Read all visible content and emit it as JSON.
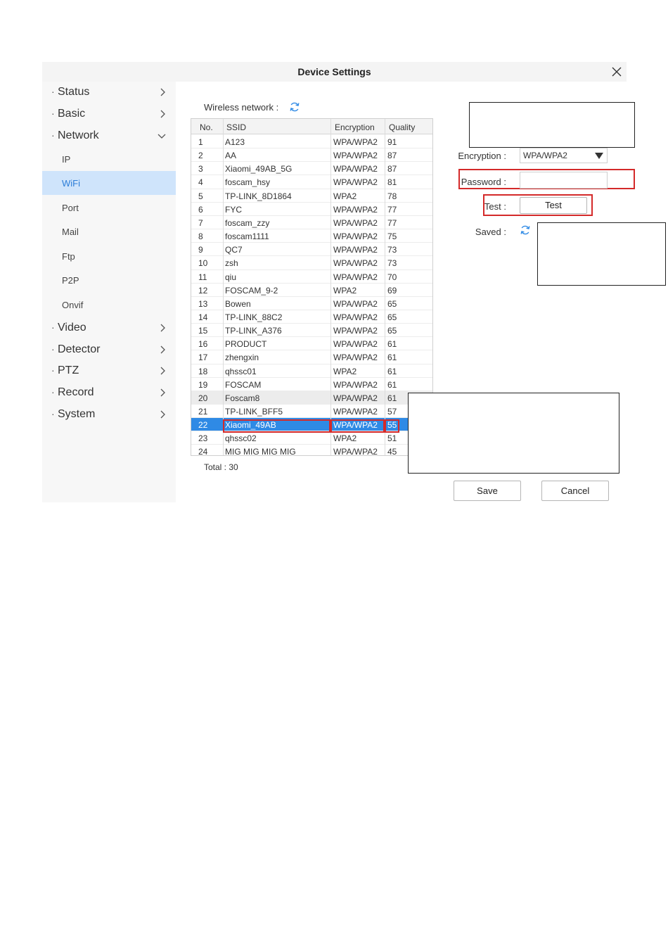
{
  "window": {
    "title": "Device Settings"
  },
  "sidebar": {
    "items": [
      {
        "label": "Status"
      },
      {
        "label": "Basic"
      },
      {
        "label": "Network"
      }
    ],
    "network_sub": [
      {
        "label": "IP"
      },
      {
        "label": "WiFi"
      },
      {
        "label": "Port"
      },
      {
        "label": "Mail"
      },
      {
        "label": "Ftp"
      },
      {
        "label": "P2P"
      },
      {
        "label": "Onvif"
      }
    ],
    "items_after": [
      {
        "label": "Video"
      },
      {
        "label": "Detector"
      },
      {
        "label": "PTZ"
      },
      {
        "label": "Record"
      },
      {
        "label": "System"
      }
    ],
    "active_sub": "WiFi"
  },
  "wifi": {
    "wireless_label": "Wireless network :",
    "columns": [
      "No.",
      "SSID",
      "Encryption",
      "Quality"
    ],
    "rows": [
      [
        "1",
        "A123",
        "WPA/WPA2",
        "91"
      ],
      [
        "2",
        "AA",
        "WPA/WPA2",
        "87"
      ],
      [
        "3",
        "Xiaomi_49AB_5G",
        "WPA/WPA2",
        "87"
      ],
      [
        "4",
        "foscam_hsy",
        "WPA/WPA2",
        "81"
      ],
      [
        "5",
        "TP-LINK_8D1864",
        "WPA2",
        "78"
      ],
      [
        "6",
        "FYC",
        "WPA/WPA2",
        "77"
      ],
      [
        "7",
        "foscam_zzy",
        "WPA/WPA2",
        "77"
      ],
      [
        "8",
        "foscam1111",
        "WPA/WPA2",
        "75"
      ],
      [
        "9",
        "QC7",
        "WPA/WPA2",
        "73"
      ],
      [
        "10",
        "zsh",
        "WPA/WPA2",
        "73"
      ],
      [
        "11",
        "qiu",
        "WPA/WPA2",
        "70"
      ],
      [
        "12",
        "FOSCAM_9-2",
        "WPA2",
        "69"
      ],
      [
        "13",
        "Bowen",
        "WPA/WPA2",
        "65"
      ],
      [
        "14",
        "TP-LINK_88C2",
        "WPA/WPA2",
        "65"
      ],
      [
        "15",
        "TP-LINK_A376",
        "WPA/WPA2",
        "65"
      ],
      [
        "16",
        "PRODUCT",
        "WPA/WPA2",
        "61"
      ],
      [
        "17",
        "zhengxin",
        "WPA/WPA2",
        "61"
      ],
      [
        "18",
        "qhssc01",
        "WPA2",
        "61"
      ],
      [
        "19",
        "FOSCAM",
        "WPA/WPA2",
        "61"
      ],
      [
        "20",
        "Foscam8",
        "WPA/WPA2",
        "61"
      ],
      [
        "21",
        "TP-LINK_BFF5",
        "WPA/WPA2",
        "57"
      ],
      [
        "22",
        "Xiaomi_49AB",
        "WPA/WPA2",
        "55"
      ],
      [
        "23",
        "qhssc02",
        "WPA2",
        "51"
      ],
      [
        "24",
        "MIG MIG MIG MIG",
        "WPA/WPA2",
        "45"
      ]
    ],
    "selected_no": "22",
    "hover_no": "20",
    "total": "Total : 30"
  },
  "form": {
    "encryption_label": "Encryption :",
    "encryption_value": "WPA/WPA2",
    "password_label": "Password :",
    "password_value": "",
    "test_label": "Test :",
    "test_button": "Test",
    "saved_label": "Saved :",
    "save_button": "Save",
    "cancel_button": "Cancel"
  },
  "colors": {
    "selected": "#2f8ae5",
    "active_nav_bg": "#cfe4fb",
    "annotation_red": "#d42a2a",
    "refresh_icon": "#2f8ae5"
  },
  "icons": {
    "close": "close-icon",
    "refresh": "refresh-icon",
    "chevron_right": "chevron-right-icon",
    "chevron_down": "chevron-down-icon",
    "dropdown": "triangle-down-icon"
  }
}
